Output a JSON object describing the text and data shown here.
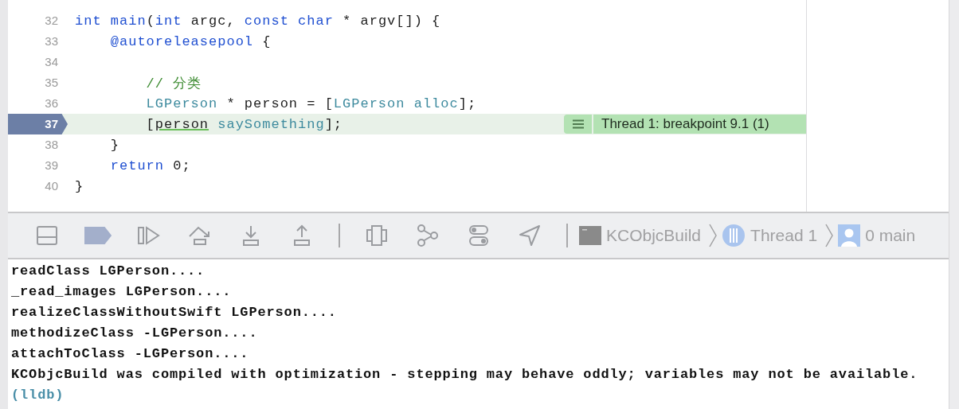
{
  "editor": {
    "lines": [
      {
        "number": "32",
        "current": false,
        "tokens": [
          {
            "text": "int",
            "kind": "keyword"
          },
          {
            "text": " main",
            "kind": "keyword"
          },
          {
            "text": "(",
            "kind": "plain"
          },
          {
            "text": "int",
            "kind": "keyword"
          },
          {
            "text": " argc, ",
            "kind": "plain"
          },
          {
            "text": "const",
            "kind": "keyword"
          },
          {
            "text": " char",
            "kind": "keyword"
          },
          {
            "text": " * argv[]) {",
            "kind": "plain"
          }
        ]
      },
      {
        "number": "33",
        "current": false,
        "tokens": [
          {
            "text": "    @autoreleasepool",
            "kind": "keyword"
          },
          {
            "text": " {",
            "kind": "plain"
          }
        ]
      },
      {
        "number": "34",
        "current": false
      },
      {
        "number": "35",
        "current": false,
        "tokens": [
          {
            "text": "        // 分类",
            "kind": "comment"
          }
        ]
      },
      {
        "number": "36",
        "current": false,
        "tokens": [
          {
            "text": "        LGPerson",
            "kind": "type"
          },
          {
            "text": " * person = [",
            "kind": "plain"
          },
          {
            "text": "LGPerson",
            "kind": "type"
          },
          {
            "text": " alloc",
            "kind": "type"
          },
          {
            "text": "];",
            "kind": "plain"
          }
        ]
      },
      {
        "number": "37",
        "current": true,
        "tokens": [
          {
            "text": "        [",
            "kind": "plain"
          },
          {
            "text": "person",
            "kind": "flagged"
          },
          {
            "text": " saySomething",
            "kind": "type"
          },
          {
            "text": "];",
            "kind": "plain"
          }
        ]
      },
      {
        "number": "38",
        "current": false,
        "tokens": [
          {
            "text": "    }",
            "kind": "plain"
          }
        ]
      },
      {
        "number": "39",
        "current": false,
        "tokens": [
          {
            "text": "    return",
            "kind": "keyword"
          },
          {
            "text": " 0;",
            "kind": "plain"
          }
        ]
      },
      {
        "number": "40",
        "current": false,
        "tokens": [
          {
            "text": "}",
            "kind": "plain"
          }
        ]
      }
    ],
    "annotation": {
      "label": "Thread 1: breakpoint 9.1 (1)"
    }
  },
  "debug_bar": {
    "buttons": [
      {
        "kind": "panel"
      },
      {
        "kind": "breakpoints",
        "active": true
      },
      {
        "kind": "continue"
      },
      {
        "kind": "step-over"
      },
      {
        "kind": "step-into"
      },
      {
        "kind": "step-out"
      },
      {
        "kind": "separator"
      },
      {
        "kind": "view-debugger"
      },
      {
        "kind": "memory-graph"
      },
      {
        "kind": "environment"
      },
      {
        "kind": "location"
      },
      {
        "kind": "separator"
      }
    ],
    "breadcrumbs": [
      {
        "kind": "app",
        "label": "KCObjcBuild"
      },
      {
        "kind": "thread",
        "label": "Thread 1"
      },
      {
        "kind": "frame",
        "label": "0 main"
      }
    ]
  },
  "console": {
    "lines": [
      {
        "text": "readClass LGPerson....",
        "kind": "output"
      },
      {
        "text": "_read_images LGPerson....",
        "kind": "output"
      },
      {
        "text": "realizeClassWithoutSwift LGPerson....",
        "kind": "output"
      },
      {
        "text": "methodizeClass -LGPerson....",
        "kind": "output"
      },
      {
        "text": "attachToClass -LGPerson....",
        "kind": "output"
      },
      {
        "text": "KCObjcBuild was compiled with optimization - stepping may behave oddly; variables may not be available.",
        "kind": "output"
      },
      {
        "text": "(lldb)",
        "kind": "prompt"
      }
    ]
  }
}
